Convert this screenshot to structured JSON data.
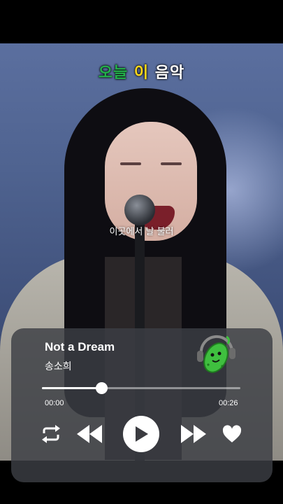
{
  "logo": {
    "part1": "오늘",
    "part2": "이",
    "part3": "음악"
  },
  "subtitle": "이곳에서 날 불러",
  "player": {
    "title": "Not a Dream",
    "artist": "송소희",
    "current_time": "00:00",
    "total_time": "00:26",
    "progress": 0.3,
    "accent_color": "#23b04a",
    "icons": [
      "repeat-icon",
      "previous-icon",
      "play-icon",
      "next-icon",
      "heart-icon",
      "cucumber-mascot-icon"
    ]
  }
}
